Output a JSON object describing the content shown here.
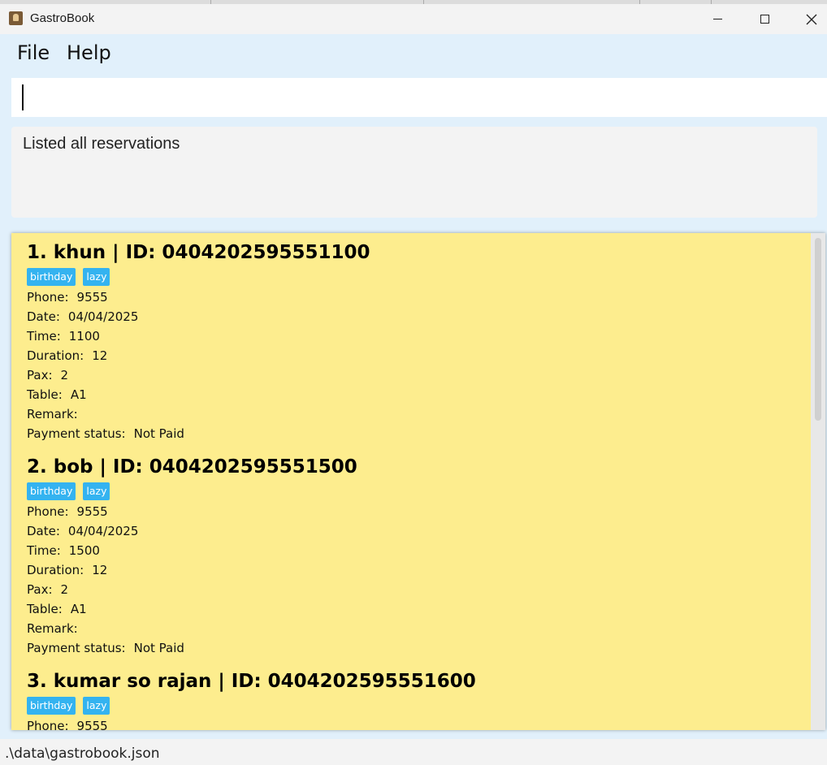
{
  "window": {
    "title": "GastroBook"
  },
  "menu": {
    "file": "File",
    "help": "Help"
  },
  "command": {
    "value": ""
  },
  "result": {
    "message": "Listed all reservations"
  },
  "labels": {
    "phone": "Phone:",
    "date": "Date:",
    "time": "Time:",
    "duration": "Duration:",
    "pax": "Pax:",
    "table": "Table:",
    "remark": "Remark:",
    "payment": "Payment status:"
  },
  "reservations": [
    {
      "title": "1. khun | ID: 0404202595551100",
      "tags": [
        "birthday",
        "lazy"
      ],
      "phone": "9555",
      "date": "04/04/2025",
      "time": "1100",
      "duration": "12",
      "pax": "2",
      "table": "A1",
      "remark": "",
      "payment": "Not Paid"
    },
    {
      "title": "2. bob | ID: 0404202595551500",
      "tags": [
        "birthday",
        "lazy"
      ],
      "phone": "9555",
      "date": "04/04/2025",
      "time": "1500",
      "duration": "12",
      "pax": "2",
      "table": "A1",
      "remark": "",
      "payment": "Not Paid"
    },
    {
      "title": "3. kumar so rajan | ID: 0404202595551600",
      "tags": [
        "birthday",
        "lazy"
      ],
      "phone": "9555"
    }
  ],
  "status": {
    "path": ".\\data\\gastrobook.json"
  },
  "colors": {
    "card_bg": "#fded8e",
    "tag_bg": "#34b3f0",
    "window_bg": "#e1f0fb"
  }
}
